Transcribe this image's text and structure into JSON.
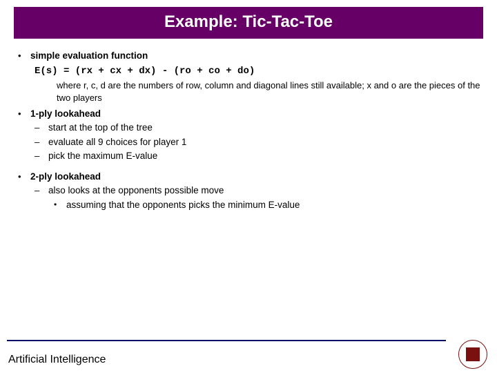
{
  "title": "Example: Tic-Tac-Toe",
  "sections": [
    {
      "heading": "simple evaluation function",
      "formula": "E(s) = (rx + cx + dx) - (ro + co + do)",
      "explain": "where r, c, d are the numbers of row, column and diagonal lines still available;  x and o are the pieces of the two players"
    },
    {
      "heading": "1-ply lookahead",
      "subs": [
        "start at the top of the tree",
        "evaluate all 9 choices for player 1",
        "pick the maximum E-value"
      ]
    },
    {
      "heading": "2-ply lookahead",
      "subs": [
        "also looks at the opponents possible move"
      ],
      "subsubs": [
        "assuming that the opponents picks the minimum E-value"
      ]
    }
  ],
  "footer": "Artificial Intelligence"
}
